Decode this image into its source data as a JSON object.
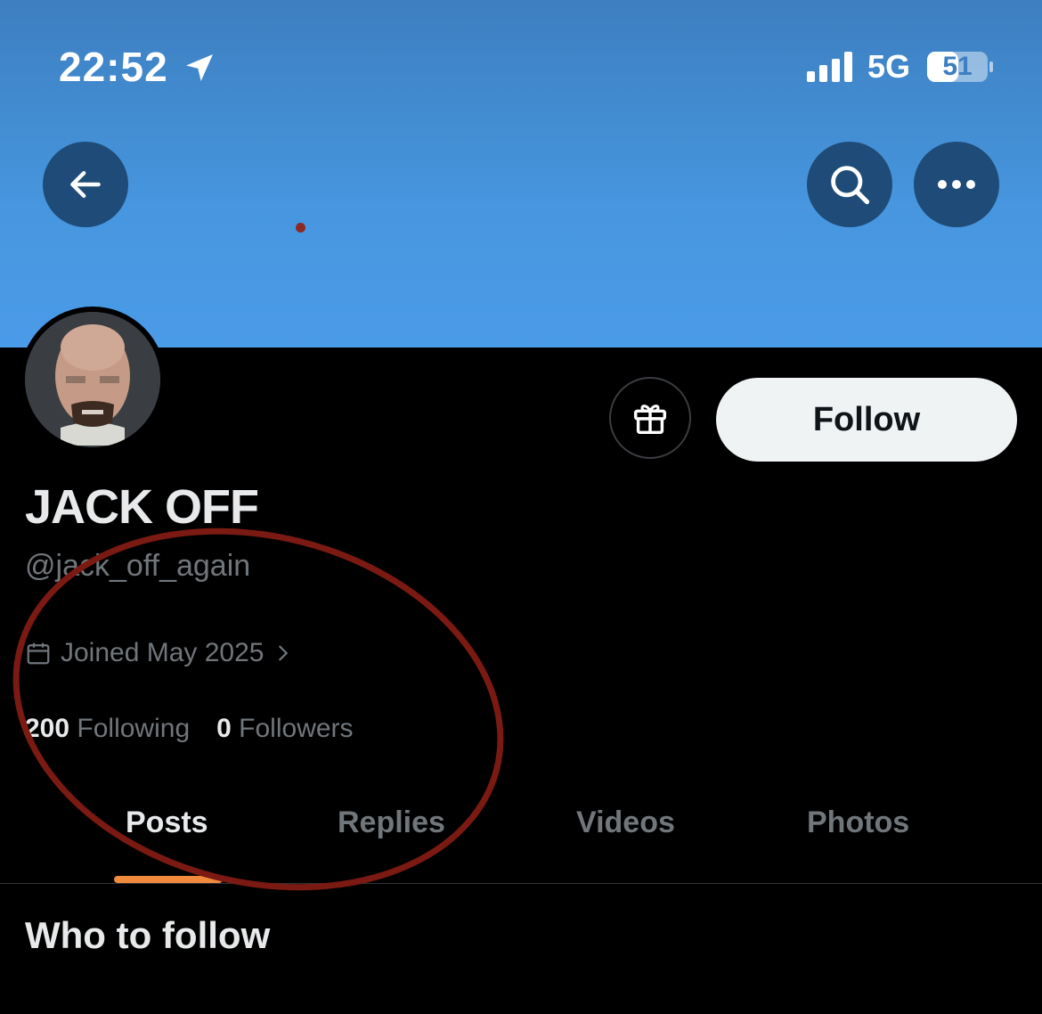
{
  "status_bar": {
    "time": "22:52",
    "network": "5G",
    "battery": "51"
  },
  "header": {
    "back_icon": "arrow-left-icon",
    "search_icon": "search-icon",
    "more_icon": "more-horizontal-icon"
  },
  "profile": {
    "name": "JACK OFF",
    "handle": "@jack_off_again",
    "joined": "Joined May 2025",
    "following_count": "200",
    "following_label": "Following",
    "followers_count": "0",
    "followers_label": "Followers",
    "follow_label": "Follow",
    "gift_icon": "gift-icon"
  },
  "tabs": [
    {
      "label": "Posts",
      "active": true
    },
    {
      "label": "Replies",
      "active": false
    },
    {
      "label": "Videos",
      "active": false
    },
    {
      "label": "Photos",
      "active": false
    }
  ],
  "section": {
    "title": "Who to follow"
  },
  "colors": {
    "banner": "#4796df",
    "tab_indicator": "#f08a3c",
    "annotation": "#7a1a12"
  }
}
